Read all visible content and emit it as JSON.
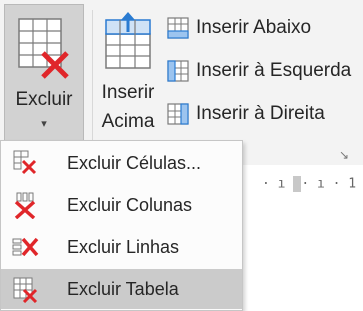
{
  "ribbon": {
    "excluir": {
      "label": "Excluir",
      "arrow": "▾"
    },
    "inserir_acima": {
      "line1": "Inserir",
      "line2": "Acima"
    },
    "insert_buttons": [
      {
        "label": "Inserir Abaixo",
        "icon": "insert-below-icon"
      },
      {
        "label": "Inserir à Esquerda",
        "icon": "insert-left-icon"
      },
      {
        "label": "Inserir à Direita",
        "icon": "insert-right-icon"
      }
    ],
    "launcher_glyph": "↘"
  },
  "ruler": {
    "text_left": "· ı ",
    "text_right": "· ı · 1 ·"
  },
  "menu": {
    "items": [
      {
        "label": "Excluir Células...",
        "icon": "delete-cells-icon",
        "highlighted": false
      },
      {
        "label": "Excluir Colunas",
        "icon": "delete-columns-icon",
        "highlighted": false
      },
      {
        "label": "Excluir Linhas",
        "icon": "delete-rows-icon",
        "highlighted": false
      },
      {
        "label": "Excluir Tabela",
        "icon": "delete-table-icon",
        "highlighted": true
      }
    ]
  },
  "colors": {
    "delete_red": "#e0262a",
    "insert_blue": "#2a7bd1",
    "highlight": "#cbcbcb"
  }
}
